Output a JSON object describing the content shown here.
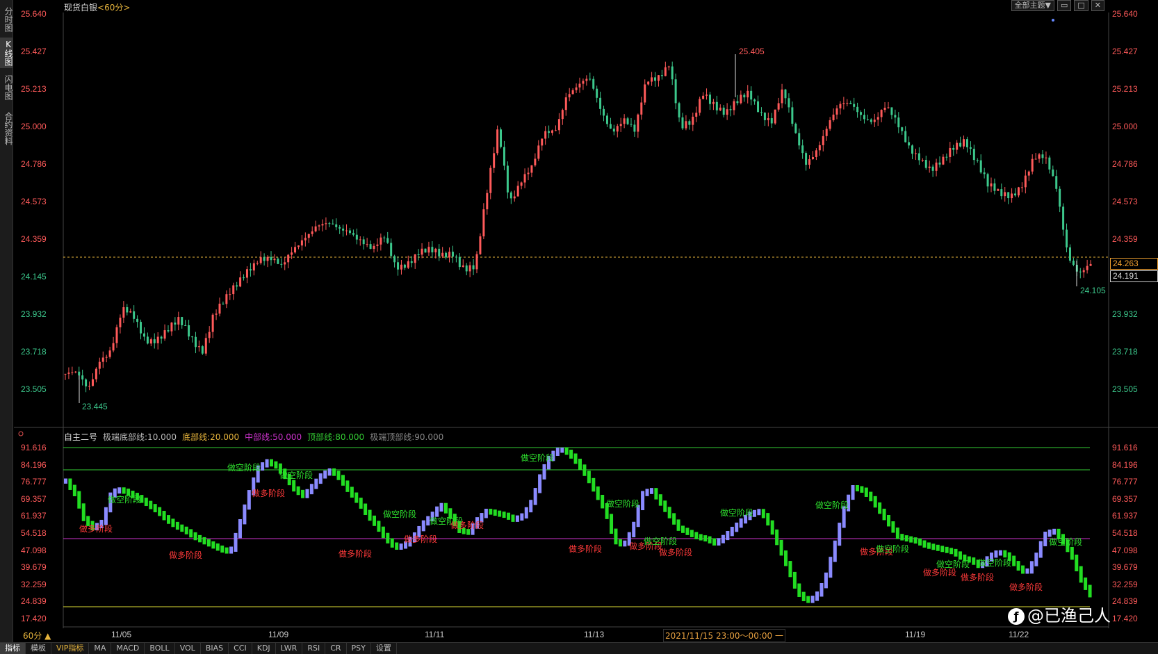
{
  "left_tabs": [
    {
      "label": "分时图",
      "active": false
    },
    {
      "label": "K线图",
      "active": true
    },
    {
      "label": "闪电图",
      "active": false
    },
    {
      "label": "合约资料",
      "active": false
    }
  ],
  "header": {
    "instrument": "现货白银",
    "period_tag": "<60分>",
    "theme_button": "全部主题▼"
  },
  "price_axis": [
    "25.640",
    "25.427",
    "25.213",
    "25.000",
    "24.786",
    "24.573",
    "24.359",
    "24.145",
    "23.932",
    "23.718",
    "23.505"
  ],
  "current_price": "24.263",
  "cursor_price": "24.191",
  "annotations": {
    "high": "25.405",
    "low_left": "23.445",
    "low_right": "24.105"
  },
  "indicator": {
    "name": "自主二号",
    "extreme_bottom": "极端底部线:10.000",
    "bottom": "底部线:20.000",
    "middle": "中部线:50.000",
    "top": "顶部线:80.000",
    "extreme_top": "极端顶部线:90.000"
  },
  "indicator_axis": [
    "91.616",
    "84.196",
    "76.777",
    "69.357",
    "61.937",
    "54.518",
    "47.098",
    "39.679",
    "32.259",
    "24.839",
    "17.420"
  ],
  "stage_labels": {
    "bear": "做空阶段",
    "bull": "做多阶段"
  },
  "period_selector": "60分 ▲",
  "x_dates": [
    "11/05",
    "11/09",
    "11/11",
    "11/13",
    "11/19",
    "11/22"
  ],
  "cursor_date": "2021/11/15 23:00～00:00 一",
  "bottom_tabs": [
    {
      "label": "指标",
      "active": true
    },
    {
      "label": "模板",
      "active": false
    },
    {
      "label": "VIP指标",
      "active": false,
      "vip": true
    },
    {
      "label": "MA",
      "active": false
    },
    {
      "label": "MACD",
      "active": false
    },
    {
      "label": "BOLL",
      "active": false
    },
    {
      "label": "VOL",
      "active": false
    },
    {
      "label": "BIAS",
      "active": false
    },
    {
      "label": "CCI",
      "active": false
    },
    {
      "label": "KDJ",
      "active": false
    },
    {
      "label": "LWR",
      "active": false
    },
    {
      "label": "RSI",
      "active": false
    },
    {
      "label": "CR",
      "active": false
    },
    {
      "label": "PSY",
      "active": false
    },
    {
      "label": "设置",
      "active": false
    }
  ],
  "watermark": "@已渔己人",
  "colors": {
    "up": "#ff5a5a",
    "down": "#3cc88c",
    "bull_bar": "#22dd22",
    "bear_bar": "#8a8aff",
    "line_top": "#33cc33",
    "line_mid": "#cc33cc",
    "line_bottom": "#dddd33",
    "dashed": "#e6b43c"
  },
  "chart_data": {
    "type": "candlestick",
    "period": "60分",
    "y_range": [
      23.505,
      25.64
    ],
    "close_path": [
      23.6,
      23.58,
      23.5,
      23.7,
      23.75,
      23.95,
      23.9,
      23.8,
      23.82,
      23.85,
      23.88,
      23.8,
      23.75,
      23.95,
      24.0,
      24.08,
      24.2,
      24.28,
      24.25,
      24.18,
      24.3,
      24.4,
      24.45,
      24.43,
      24.4,
      24.42,
      24.38,
      24.3,
      24.35,
      24.2,
      24.25,
      24.3,
      24.28,
      24.25,
      24.3,
      24.22,
      24.2,
      24.6,
      25.0,
      24.6,
      24.7,
      24.75,
      24.95,
      25.0,
      25.2,
      25.22,
      25.25,
      25.1,
      25.0,
      25.05,
      24.95,
      25.25,
      25.3,
      25.38,
      24.98,
      25.0,
      25.2,
      25.15,
      25.08,
      25.12,
      25.18,
      25.1,
      25.05,
      25.2,
      24.95,
      24.8,
      24.9,
      25.02,
      25.1,
      25.12,
      25.08,
      25.05,
      25.1,
      25.0,
      24.9,
      24.85,
      24.75,
      24.78,
      24.88,
      24.95,
      24.82,
      24.65,
      24.6,
      24.62,
      24.7,
      24.82,
      24.8,
      24.65,
      24.3,
      24.18,
      24.2
    ],
    "indicator_path": [
      76,
      70,
      58,
      54,
      57,
      71,
      72,
      70,
      68,
      65,
      62,
      58,
      55,
      53,
      50,
      48,
      46,
      44,
      43,
      56,
      70,
      82,
      85,
      83,
      78,
      72,
      69,
      74,
      79,
      81,
      77,
      71,
      66,
      60,
      55,
      49,
      45,
      46,
      50,
      56,
      60,
      65,
      60,
      53,
      52,
      58,
      62,
      61,
      60,
      58,
      60,
      67,
      80,
      88,
      91,
      89,
      84,
      78,
      70,
      62,
      48,
      46,
      54,
      70,
      72,
      66,
      60,
      54,
      52,
      50,
      49,
      47,
      50,
      54,
      58,
      61,
      62,
      55,
      45,
      35,
      24,
      20,
      22,
      30,
      45,
      62,
      73,
      72,
      68,
      62,
      56,
      50,
      49,
      48,
      46,
      45,
      44,
      43,
      40,
      39,
      36,
      41,
      43,
      41,
      36,
      33,
      40,
      51,
      53,
      48,
      41,
      30,
      23
    ]
  }
}
